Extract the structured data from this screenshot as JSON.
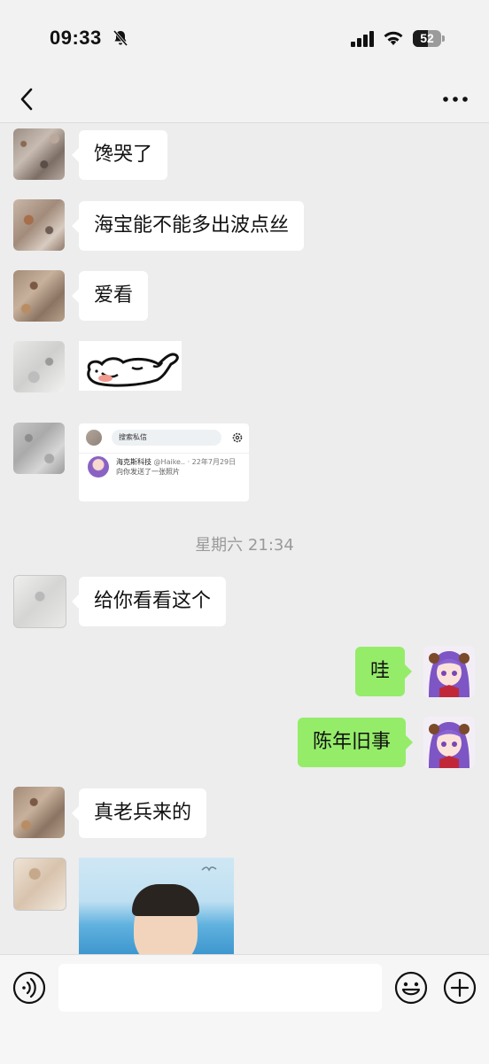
{
  "status_bar": {
    "time": "09:33",
    "battery": "52"
  },
  "nav": {
    "back_icon": "chevron-left-icon",
    "more_icon": "more-dots-icon"
  },
  "messages": [
    {
      "sender": "other",
      "text": "馋哭了"
    },
    {
      "sender": "other",
      "text": "海宝能不能多出波点丝"
    },
    {
      "sender": "other",
      "text": "爱看"
    },
    {
      "sender": "other",
      "type": "sticker",
      "description": "cat-sticker"
    },
    {
      "sender": "other",
      "type": "image",
      "card": {
        "search_placeholder": "搜索私信",
        "name": "海克斯科技",
        "handle": "@Haike..",
        "date": "· 22年7月29日",
        "preview": "向你发送了一张照片"
      }
    },
    {
      "sender": "other",
      "text": "给你看看这个"
    },
    {
      "sender": "me",
      "text": "哇"
    },
    {
      "sender": "me",
      "text": "陈年旧事"
    },
    {
      "sender": "other",
      "text": "真老兵来的"
    },
    {
      "sender": "other",
      "type": "image",
      "description": "photo-boy-sea"
    }
  ],
  "timestamp": "星期六 21:34",
  "input_bar": {
    "voice_icon": "voice-icon",
    "emoji_icon": "emoji-icon",
    "plus_icon": "plus-icon",
    "value": ""
  },
  "colors": {
    "my_bubble": "#95ec69",
    "other_bubble": "#ffffff",
    "background": "#ededed"
  }
}
